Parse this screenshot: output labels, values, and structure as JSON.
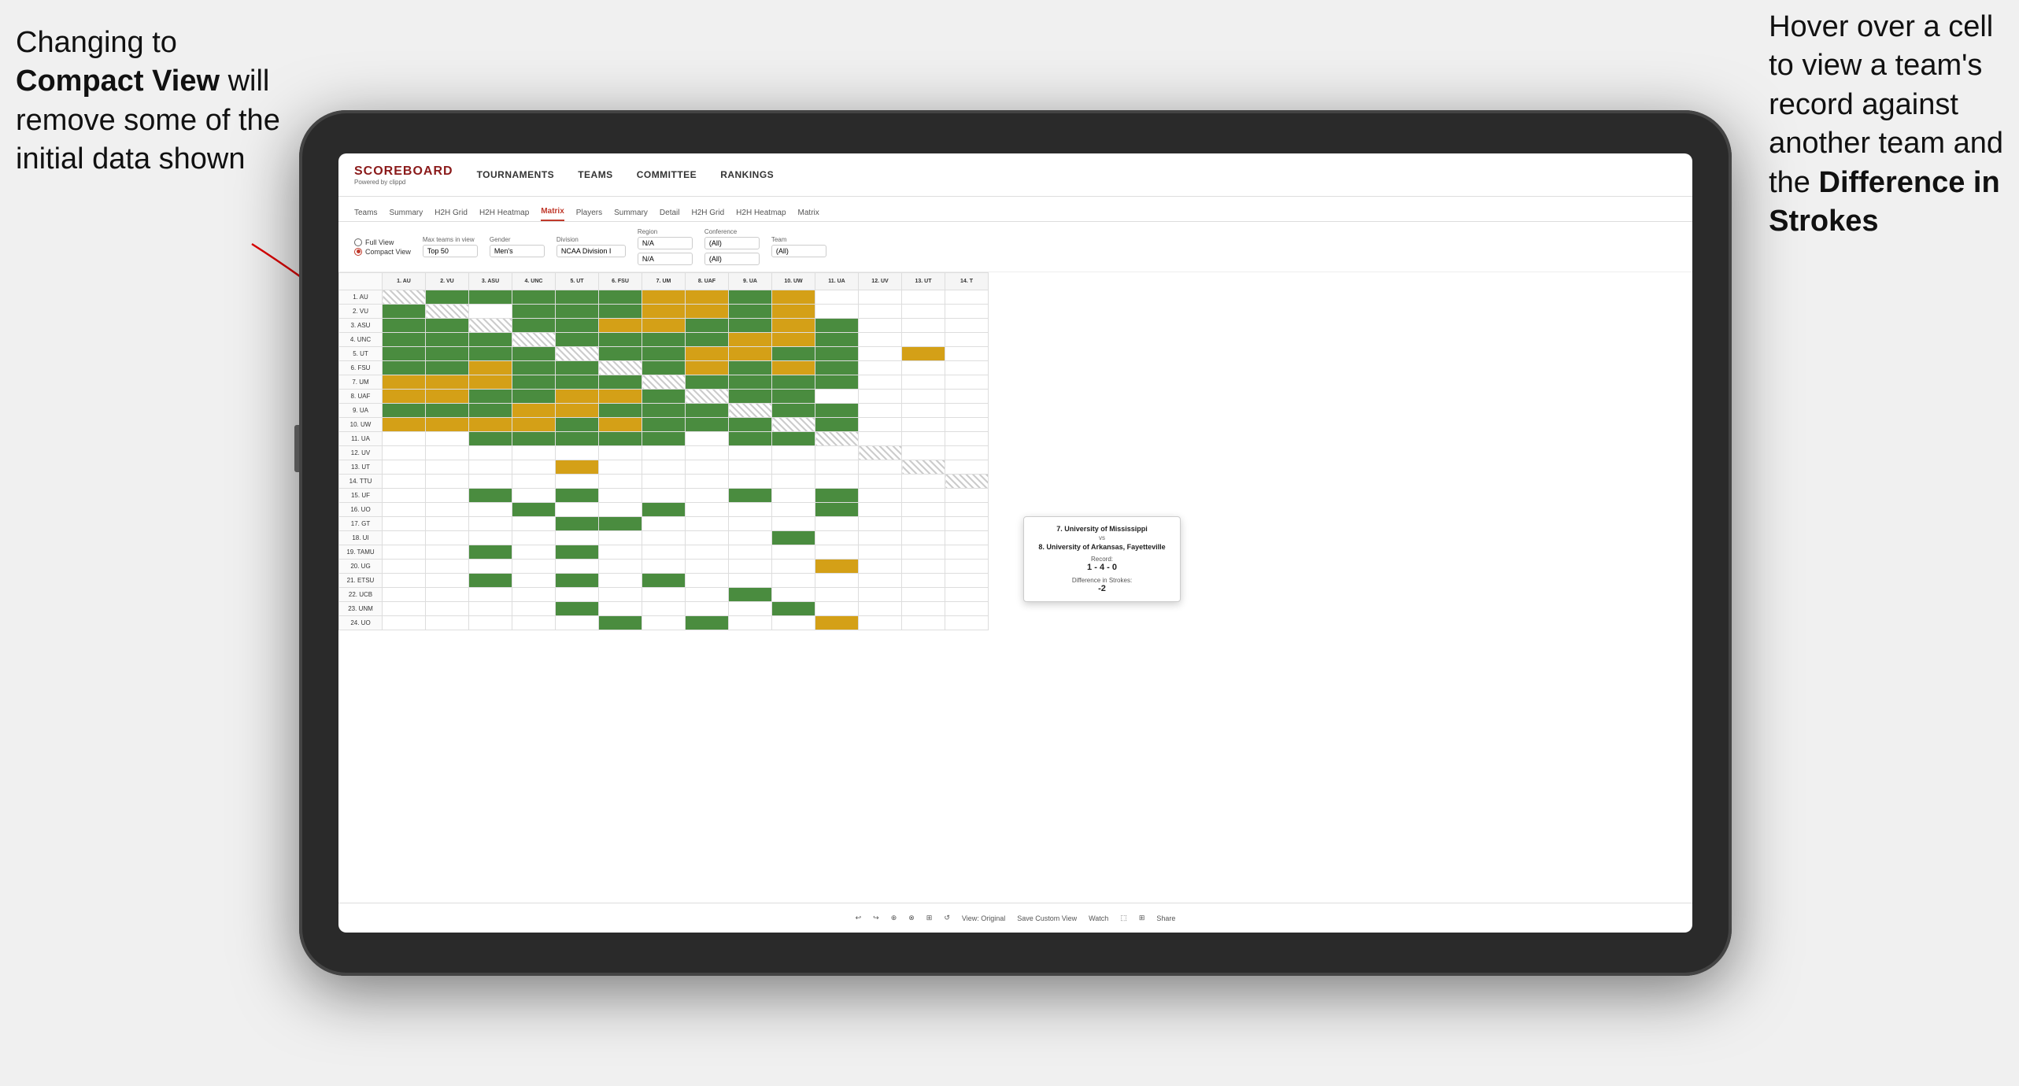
{
  "annotations": {
    "left": {
      "line1": "Changing to",
      "line2_bold": "Compact View",
      "line2_rest": " will",
      "line3": "remove some of the",
      "line4": "initial data shown"
    },
    "right": {
      "line1": "Hover over a cell",
      "line2": "to view a team's",
      "line3": "record against",
      "line4": "another team and",
      "line5_pre": "the ",
      "line5_bold": "Difference in",
      "line6_bold": "Strokes"
    }
  },
  "header": {
    "logo": "SCOREBOARD",
    "logo_sub": "Powered by clippd",
    "nav": [
      "TOURNAMENTS",
      "TEAMS",
      "COMMITTEE",
      "RANKINGS"
    ]
  },
  "subnav": {
    "tabs": [
      "Teams",
      "Summary",
      "H2H Grid",
      "H2H Heatmap",
      "Matrix",
      "Players",
      "Summary",
      "Detail",
      "H2H Grid",
      "H2H Heatmap",
      "Matrix"
    ],
    "active": "Matrix"
  },
  "controls": {
    "view_label_full": "Full View",
    "view_label_compact": "Compact View",
    "max_teams_label": "Max teams in view",
    "max_teams_value": "Top 50",
    "gender_label": "Gender",
    "gender_value": "Men's",
    "division_label": "Division",
    "division_value": "NCAA Division I",
    "region_label": "Region",
    "region_value": "N/A",
    "region_value2": "N/A",
    "conference_label": "Conference",
    "conference_value": "(All)",
    "conference_value2": "(All)",
    "team_label": "Team",
    "team_value": "(All)"
  },
  "col_headers": [
    "1. AU",
    "2. VU",
    "3. ASU",
    "4. UNC",
    "5. UT",
    "6. FSU",
    "7. UM",
    "8. UAF",
    "9. UA",
    "10. UW",
    "11. UA",
    "12. UV",
    "13. UT",
    "14. T"
  ],
  "row_headers": [
    "1. AU",
    "2. VU",
    "3. ASU",
    "4. UNC",
    "5. UT",
    "6. FSU",
    "7. UM",
    "8. UAF",
    "9. UA",
    "10. UW",
    "11. UA",
    "12. UV",
    "13. UT",
    "14. TTU",
    "15. UF",
    "16. UO",
    "17. GT",
    "18. UI",
    "19. TAMU",
    "20. UG",
    "21. ETSU",
    "22. UCB",
    "23. UNM",
    "24. UO"
  ],
  "tooltip": {
    "team1": "7. University of Mississippi",
    "vs": "vs",
    "team2": "8. University of Arkansas, Fayetteville",
    "record_label": "Record:",
    "record": "1 - 4 - 0",
    "strokes_label": "Difference in Strokes:",
    "strokes": "-2"
  },
  "toolbar": {
    "undo": "↩",
    "redo": "↪",
    "view_original": "View: Original",
    "save_custom": "Save Custom View",
    "watch": "Watch",
    "share": "Share"
  }
}
